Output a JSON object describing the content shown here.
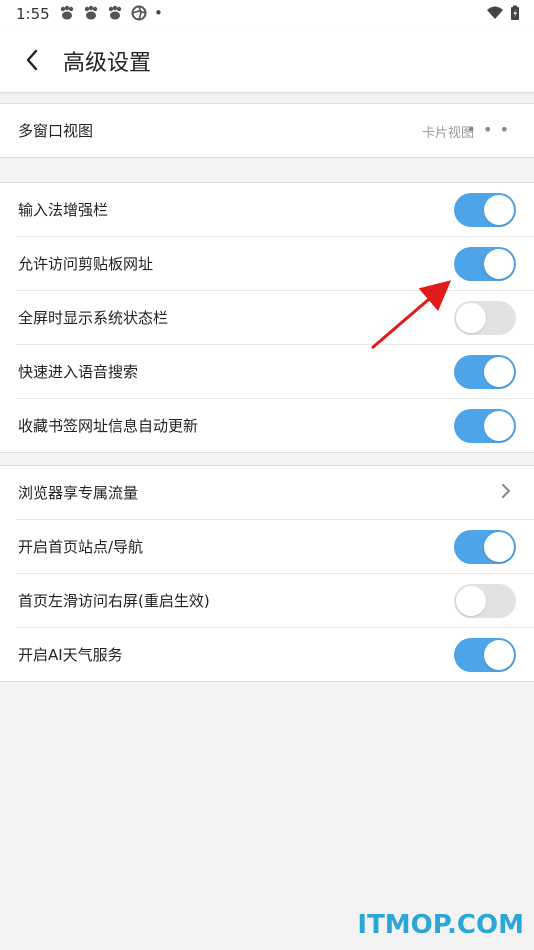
{
  "statusbar": {
    "time": "1:55",
    "dot": "•"
  },
  "appbar": {
    "title": "高级设置",
    "back_icon": "chevron-left-icon"
  },
  "section1": {
    "items": [
      {
        "label": "多窗口视图",
        "value": "卡片视图",
        "more": "• • •"
      }
    ]
  },
  "section2": {
    "items": [
      {
        "label": "输入法增强栏",
        "toggle": true
      },
      {
        "label": "允许访问剪贴板网址",
        "toggle": true
      },
      {
        "label": "全屏时显示系统状态栏",
        "toggle": false
      },
      {
        "label": "快速进入语音搜索",
        "toggle": true
      },
      {
        "label": "收藏书签网址信息自动更新",
        "toggle": true
      }
    ]
  },
  "section3": {
    "items": [
      {
        "label": "浏览器享专属流量"
      },
      {
        "label": "开启首页站点/导航",
        "toggle": true
      },
      {
        "label": "首页左滑访问右屏(重启生效)",
        "toggle": false
      },
      {
        "label": "开启AI天气服务",
        "toggle": true
      }
    ]
  },
  "watermark": "ITMOP.COM",
  "colors": {
    "toggle_on": "#4ea4e8",
    "toggle_off": "#e2e2e2",
    "arrow": "#e01b1b",
    "watermark": "#2aa6d8"
  }
}
